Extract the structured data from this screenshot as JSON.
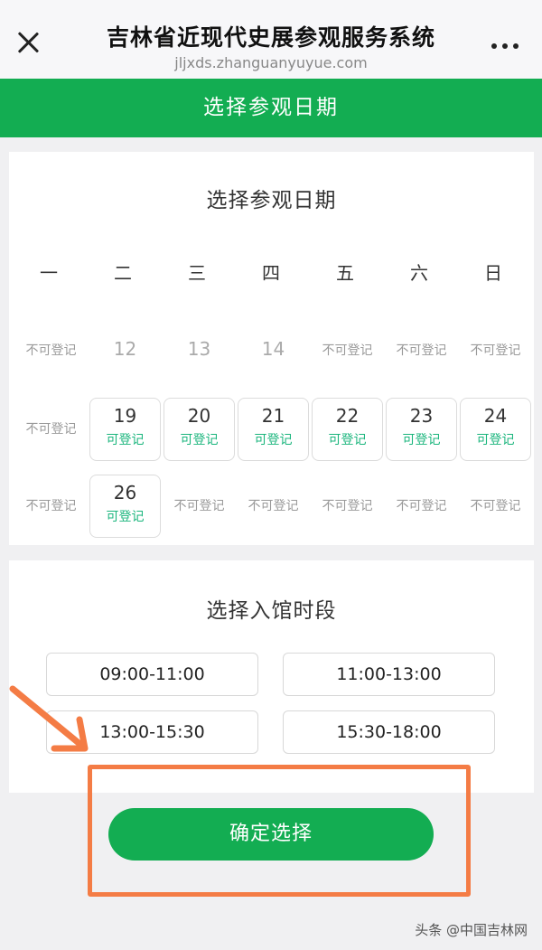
{
  "header": {
    "title": "吉林省近现代史展参观服务系统",
    "url": "jljxds.zhanguanyuyue.com",
    "close_icon": "close-icon",
    "more_icon": "more-dots-icon"
  },
  "page_title": "选择参观日期",
  "date_card": {
    "title": "选择参观日期",
    "weekdays": [
      "一",
      "二",
      "三",
      "四",
      "五",
      "六",
      "日"
    ],
    "weeks": [
      [
        {
          "num": "",
          "status": "不可登记",
          "available": false
        },
        {
          "num": "12",
          "status": "",
          "available": false
        },
        {
          "num": "13",
          "status": "",
          "available": false
        },
        {
          "num": "14",
          "status": "",
          "available": false
        },
        {
          "num": "",
          "status": "不可登记",
          "available": false
        },
        {
          "num": "",
          "status": "不可登记",
          "available": false
        },
        {
          "num": "",
          "status": "不可登记",
          "available": false
        }
      ],
      [
        {
          "num": "",
          "status": "不可登记",
          "available": false
        },
        {
          "num": "19",
          "status": "可登记",
          "available": true
        },
        {
          "num": "20",
          "status": "可登记",
          "available": true
        },
        {
          "num": "21",
          "status": "可登记",
          "available": true
        },
        {
          "num": "22",
          "status": "可登记",
          "available": true
        },
        {
          "num": "23",
          "status": "可登记",
          "available": true
        },
        {
          "num": "24",
          "status": "可登记",
          "available": true
        }
      ],
      [
        {
          "num": "",
          "status": "不可登记",
          "available": false
        },
        {
          "num": "26",
          "status": "可登记",
          "available": true
        },
        {
          "num": "",
          "status": "不可登记",
          "available": false
        },
        {
          "num": "",
          "status": "不可登记",
          "available": false
        },
        {
          "num": "",
          "status": "不可登记",
          "available": false
        },
        {
          "num": "",
          "status": "不可登记",
          "available": false
        },
        {
          "num": "",
          "status": "不可登记",
          "available": false
        }
      ]
    ]
  },
  "time_card": {
    "title": "选择入馆时段",
    "slots": [
      "09:00-11:00",
      "11:00-13:00",
      "13:00-15:30",
      "15:30-18:00"
    ]
  },
  "confirm_label": "确定选择",
  "watermark": "头条 @中国吉林网",
  "colors": {
    "brand_green": "#13ad52",
    "available_text": "#19b57c",
    "annotation_orange": "#f47c45"
  }
}
